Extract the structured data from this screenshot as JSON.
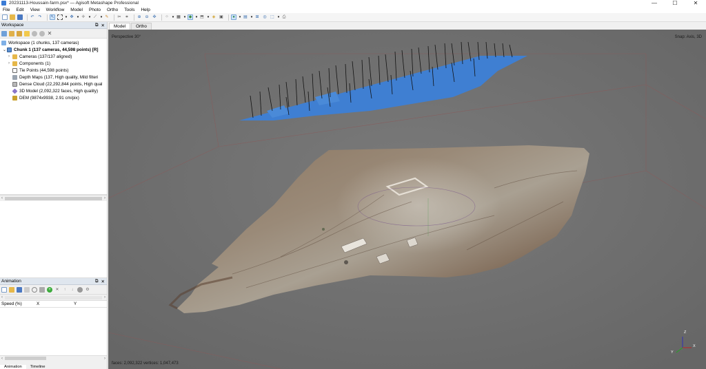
{
  "window": {
    "title": "20231113-Houssain-farm.psx* — Agisoft Metashape Professional",
    "minimize": "—",
    "maximize": "☐",
    "close": "✕"
  },
  "menu": [
    "File",
    "Edit",
    "View",
    "Workflow",
    "Model",
    "Photo",
    "Ortho",
    "Tools",
    "Help"
  ],
  "workspace": {
    "panel_title": "Workspace",
    "root": "Workspace (1 chunks, 137 cameras)",
    "chunk": "Chunk 1 (137 cameras, 44,598 points) [R]",
    "items": [
      "Cameras (137/137 aligned)",
      "Components (1)",
      "Tie Points (44,598 points)",
      "Depth Maps (137, High quality, Mild filteri",
      "Dense Cloud (22,292,844 points, High qual",
      "3D Model (2,092,322 faces, High quality)",
      "DEM (9874x9938, 2.91 cm/pix)"
    ]
  },
  "animation": {
    "panel_title": "Animation",
    "columns": [
      "Speed (%)",
      "X",
      "Y"
    ],
    "tabs": [
      "Animation",
      "Timeline"
    ]
  },
  "view_tabs": [
    "Model",
    "Ortho"
  ],
  "viewport": {
    "projection": "Perspective 30°",
    "snap": "Snap: Axis, 3D",
    "stats": "faces: 2,092,322 vertices: 1,047,473",
    "axis_z": "Z",
    "axis_x": "X",
    "axis_y": "Y"
  },
  "colors": {
    "viewport_bg": "#707070",
    "camera_plane": "#3f7fd2",
    "accent": "#3a7bd5"
  }
}
